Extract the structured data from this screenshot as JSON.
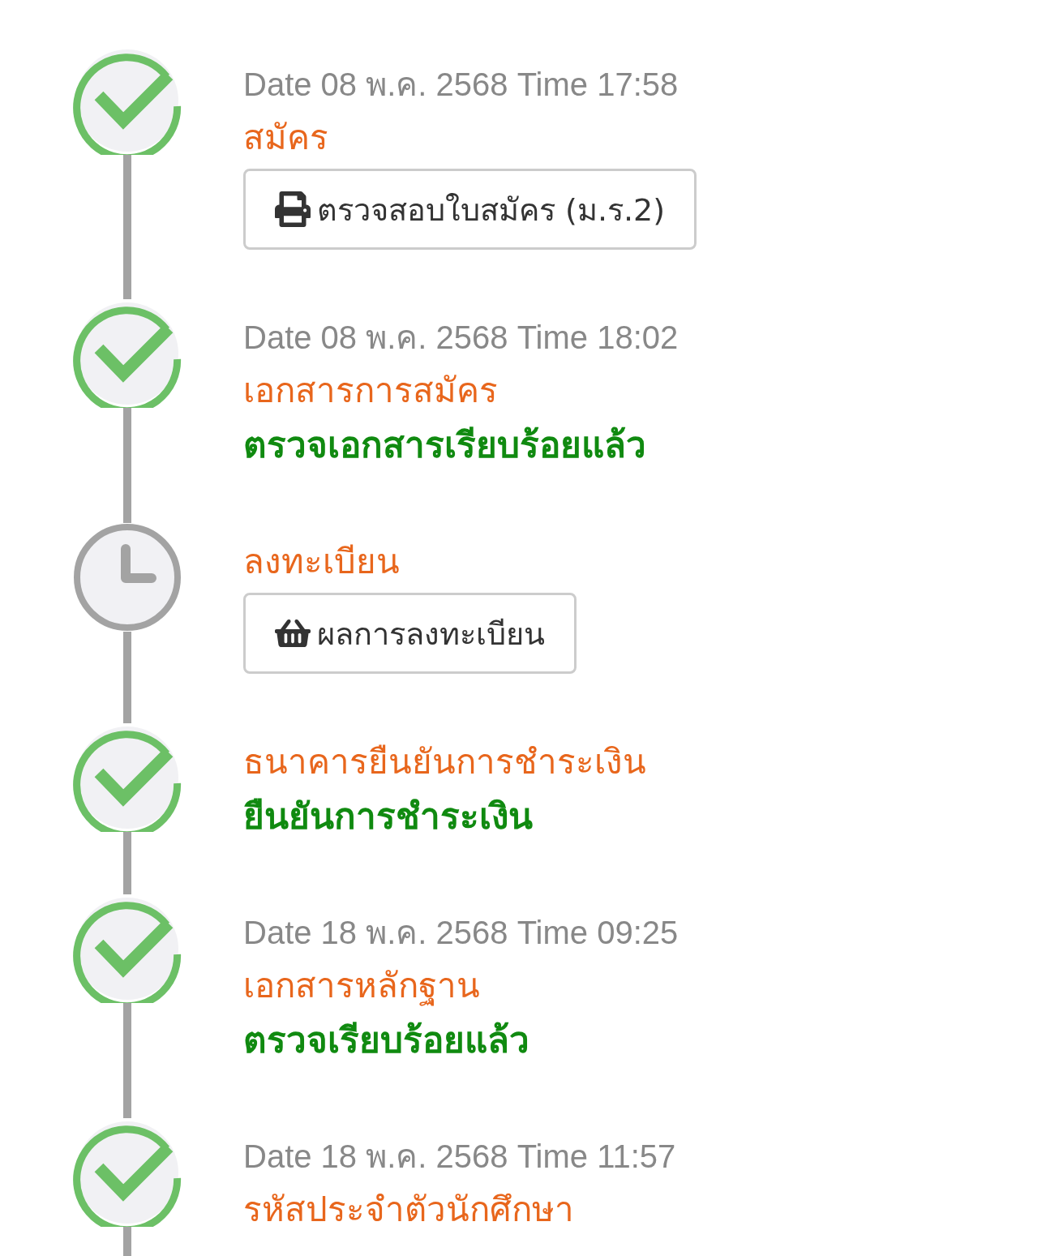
{
  "steps": [
    {
      "completed": true,
      "date": "Date 08 พ.ค. 2568 Time 17:58",
      "title": "สมัคร",
      "button": {
        "kind": "printer",
        "label": "ตรวจสอบใบสมัคร (ม.ร.2)"
      }
    },
    {
      "completed": true,
      "date": "Date 08 พ.ค. 2568 Time 18:02",
      "title": "เอกสารการสมัคร",
      "note": "ตรวจเอกสารเรียบร้อยแล้ว"
    },
    {
      "completed": false,
      "title": "ลงทะเบียน",
      "button": {
        "kind": "basket",
        "label": "ผลการลงทะเบียน"
      }
    },
    {
      "completed": true,
      "title": "ธนาคารยืนยันการชำระเงิน",
      "note": "ยืนยันการชำระเงิน"
    },
    {
      "completed": true,
      "date": "Date 18 พ.ค. 2568 Time 09:25",
      "title": "เอกสารหลักฐาน",
      "note": "ตรวจเรียบร้อยแล้ว"
    },
    {
      "completed": true,
      "date": "Date 18 พ.ค. 2568 Time 11:57",
      "title": "รหัสประจำตัวนักศึกษา"
    }
  ]
}
